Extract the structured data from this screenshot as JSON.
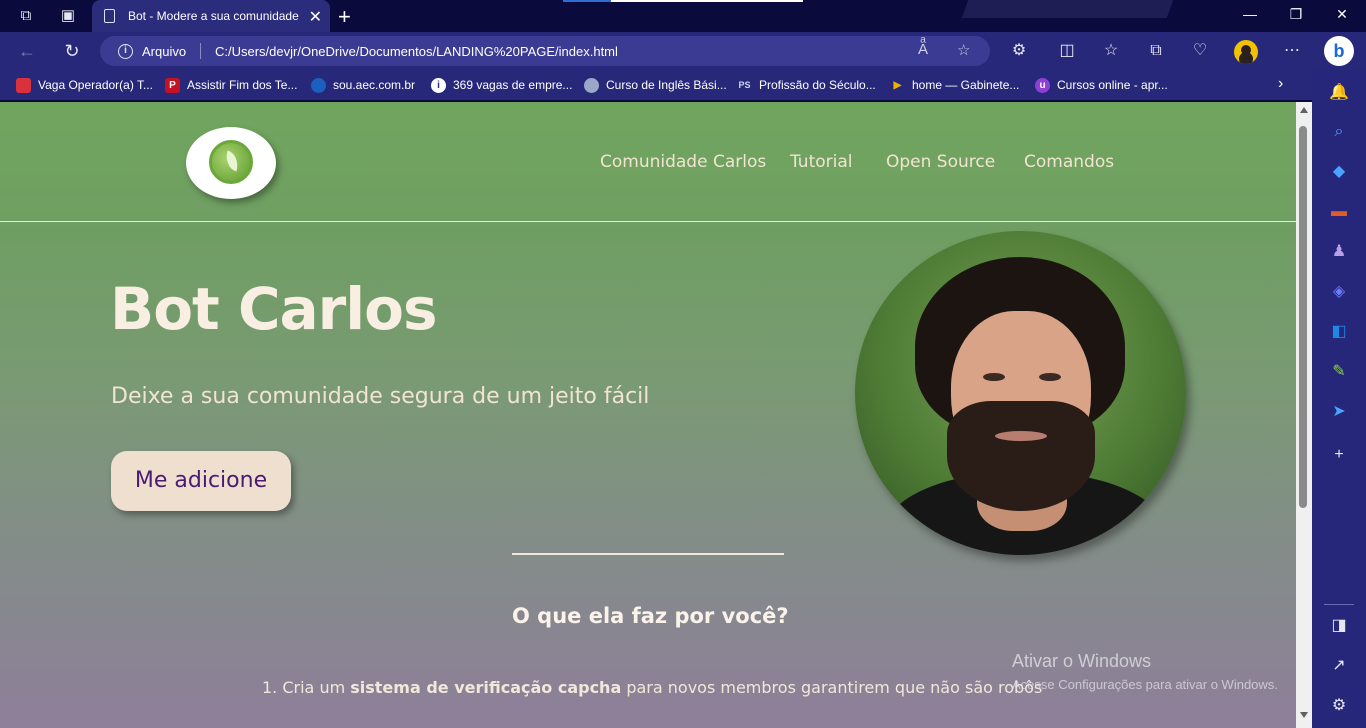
{
  "browser": {
    "tab": {
      "title": "Bot - Modere a sua comunidade"
    },
    "address": {
      "label": "Arquivo",
      "url": "C:/Users/devjr/OneDrive/Documentos/LANDING%20PAGE/index.html"
    },
    "bookmarks": [
      {
        "label": "Vaga Operador(a) T...",
        "color": "#d9323c",
        "icon": "flag-icon"
      },
      {
        "label": "Assistir Fim dos Te...",
        "color": "#c41222",
        "icon": "p-logo-icon"
      },
      {
        "label": "sou.aec.com.br",
        "color": "#1b5fbf",
        "icon": "aec-logo-icon"
      },
      {
        "label": "369 vagas de empre...",
        "color": "#ffffff",
        "icon": "info-icon"
      },
      {
        "label": "Curso de Inglês Bási...",
        "color": "#9aa7c9",
        "icon": "globe-icon"
      },
      {
        "label": "Profissão do Século...",
        "color": "#2f6ee0",
        "icon": "ps-logo-icon"
      },
      {
        "label": "home — Gabinete...",
        "color": "#e8b400",
        "icon": "play-icon"
      },
      {
        "label": "Cursos online - apr...",
        "color": "#8e3fd8",
        "icon": "udemy-icon"
      }
    ]
  },
  "site": {
    "nav": [
      "Comunidade Carlos",
      "Tutorial",
      "Open Source",
      "Comandos"
    ],
    "hero": {
      "title": "Bot Carlos",
      "subtitle": "Deixe a sua comunidade segura de um jeito fácil",
      "cta": "Me adicione"
    },
    "section_title": "O que ela faz por você?",
    "features": [
      {
        "prefix": "1. Cria um ",
        "bold": "sistema de verificação capcha",
        "suffix": " para novos membros garantirem que não são robôs"
      }
    ]
  },
  "watermark": {
    "title": "Ativar o Windows",
    "subtitle": "Acesse Configurações para ativar o Windows."
  },
  "colors": {
    "accent_green": "#71a55e",
    "cta_bg": "#efdfcf",
    "cta_text": "#4b1a73",
    "browser_chrome": "#28287a"
  }
}
